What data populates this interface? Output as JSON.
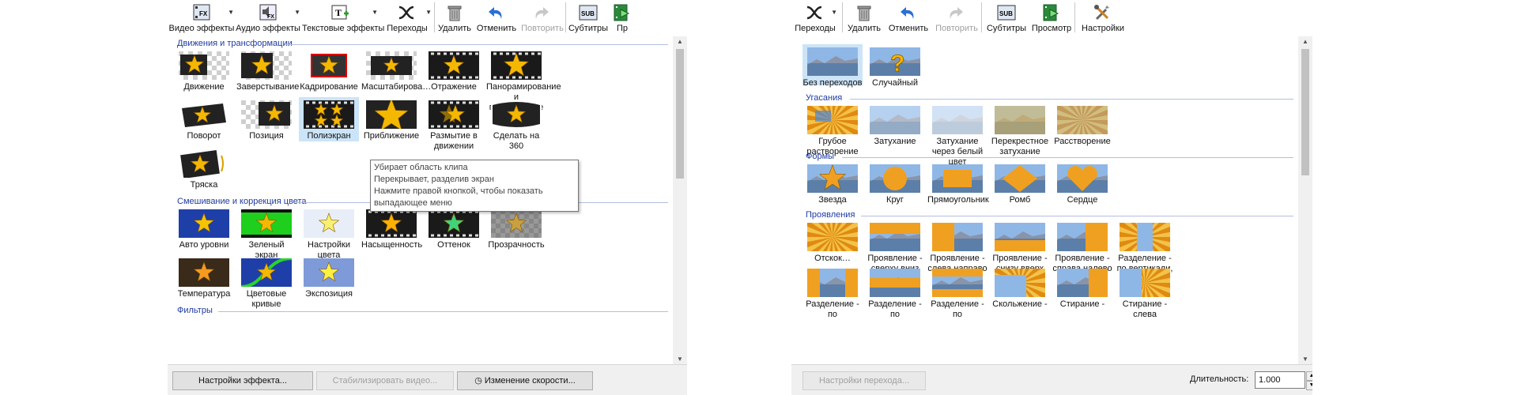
{
  "left_panel": {
    "toolbar": [
      {
        "name": "video-effects-button",
        "icon": "video-fx-icon",
        "label": "Видео эффекты",
        "dropdown": true,
        "enabled": true
      },
      {
        "name": "audio-effects-button",
        "icon": "audio-fx-icon",
        "label": "Аудио эффекты",
        "dropdown": true,
        "enabled": true
      },
      {
        "name": "text-effects-button",
        "icon": "text-fx-icon",
        "label": "Текстовые эффекты",
        "dropdown": true,
        "enabled": true
      },
      {
        "name": "transitions-button",
        "icon": "transitions-icon",
        "label": "Переходы",
        "dropdown": true,
        "enabled": true
      },
      {
        "name": "delete-button",
        "icon": "trash-icon",
        "label": "Удалить",
        "enabled": true
      },
      {
        "name": "undo-button",
        "icon": "undo-icon",
        "label": "Отменить",
        "enabled": true
      },
      {
        "name": "redo-button",
        "icon": "redo-icon",
        "label": "Повторить",
        "enabled": false
      },
      {
        "name": "subtitles-button",
        "icon": "subtitles-icon",
        "label": "Субтитры",
        "enabled": true
      },
      {
        "name": "preview-button",
        "icon": "preview-icon",
        "label": "Пр",
        "enabled": true
      }
    ],
    "categories": [
      {
        "title": "Движения и трансформации",
        "items": [
          {
            "label": "Движение",
            "thumb": "movement"
          },
          {
            "label": "Заверстывание",
            "thumb": "wrap"
          },
          {
            "label": "Кадрирование",
            "thumb": "crop"
          },
          {
            "label": "Масштабирова…",
            "thumb": "scale"
          },
          {
            "label": "Отражение",
            "thumb": "reflection"
          },
          {
            "label": "Панорамирование и приближение",
            "thumb": "pan"
          },
          {
            "label": "Поворот",
            "thumb": "rotate"
          },
          {
            "label": "Позиция",
            "thumb": "position"
          },
          {
            "label": "Полиэкран",
            "thumb": "multiscreen",
            "selected": true
          },
          {
            "label": "Приближение",
            "thumb": "zoom"
          },
          {
            "label": "Размытие в движении",
            "thumb": "motionblur"
          },
          {
            "label": "Сделать на 360",
            "thumb": "360"
          },
          {
            "label": "Тряска",
            "thumb": "shake"
          }
        ]
      },
      {
        "title": "Смешивание и коррекция цвета",
        "items": [
          {
            "label": "Авто уровни",
            "thumb": "autolevels"
          },
          {
            "label": "Зеленый экран",
            "thumb": "greenscreen"
          },
          {
            "label": "Настройки цвета",
            "thumb": "colorsettings"
          },
          {
            "label": "Насыщенность",
            "thumb": "saturation"
          },
          {
            "label": "Оттенок",
            "thumb": "hue"
          },
          {
            "label": "Прозрачность",
            "thumb": "transparency"
          },
          {
            "label": "Температура",
            "thumb": "temperature"
          },
          {
            "label": "Цветовые кривые",
            "thumb": "curves"
          },
          {
            "label": "Экспозиция",
            "thumb": "exposure"
          }
        ]
      },
      {
        "title": "Фильтры",
        "items": []
      }
    ],
    "tooltip": [
      "Убирает область клипа",
      "Перекрывает, разделив экран",
      "Нажмите правой кнопкой, чтобы показать",
      "выпадающее меню"
    ],
    "bottom_buttons": [
      {
        "name": "effect-settings-button",
        "label": "Настройки эффекта...",
        "enabled": true
      },
      {
        "name": "stabilize-video-button",
        "label": "Стабилизировать видео...",
        "enabled": false
      },
      {
        "name": "change-speed-button",
        "label": "Изменение скорости...",
        "enabled": true
      }
    ]
  },
  "right_panel": {
    "toolbar": [
      {
        "name": "transitions-button",
        "icon": "transitions-icon",
        "label": "Переходы",
        "dropdown": true,
        "enabled": true
      },
      {
        "name": "delete-button",
        "icon": "trash-icon",
        "label": "Удалить",
        "enabled": true
      },
      {
        "name": "undo-button",
        "icon": "undo-icon",
        "label": "Отменить",
        "enabled": true
      },
      {
        "name": "redo-button",
        "icon": "redo-icon",
        "label": "Повторить",
        "enabled": false
      },
      {
        "name": "subtitles-button",
        "icon": "subtitles-icon",
        "label": "Субтитры",
        "enabled": true
      },
      {
        "name": "preview-button",
        "icon": "preview-icon",
        "label": "Просмотр",
        "enabled": true
      },
      {
        "name": "settings-button",
        "icon": "tools-icon",
        "label": "Настройки",
        "enabled": true
      }
    ],
    "categories": [
      {
        "title": "",
        "items": [
          {
            "label": "Без переходов",
            "thumb": "none",
            "selected": true
          },
          {
            "label": "Случайный",
            "thumb": "random"
          }
        ]
      },
      {
        "title": "Угасания",
        "items": [
          {
            "label": "Грубое растворение",
            "thumb": "roughdissolve"
          },
          {
            "label": "Затухание",
            "thumb": "fade"
          },
          {
            "label": "Затухание через белый цвет",
            "thumb": "fadewhite"
          },
          {
            "label": "Перекрестное затухание",
            "thumb": "crossfade"
          },
          {
            "label": "Расстворение",
            "thumb": "dissolve"
          }
        ]
      },
      {
        "title": "Формы",
        "items": [
          {
            "label": "Звезда",
            "thumb": "star"
          },
          {
            "label": "Круг",
            "thumb": "circle"
          },
          {
            "label": "Прямоугольник",
            "thumb": "rect"
          },
          {
            "label": "Ромб",
            "thumb": "diamond"
          },
          {
            "label": "Сердце",
            "thumb": "heart"
          }
        ]
      },
      {
        "title": "Проявления",
        "items": [
          {
            "label": "Отскок…",
            "thumb": "bounce"
          },
          {
            "label": "Проявление - сверху вниз",
            "thumb": "wipe-down"
          },
          {
            "label": "Проявление - слева направо",
            "thumb": "wipe-right"
          },
          {
            "label": "Проявление - снизу вверх",
            "thumb": "wipe-up"
          },
          {
            "label": "Проявление - справа налево",
            "thumb": "wipe-left"
          },
          {
            "label": "Разделение - по вертикали, конец",
            "thumb": "split-vend"
          },
          {
            "label": "Разделение - по",
            "thumb": "split1"
          },
          {
            "label": "Разделение - по",
            "thumb": "split2"
          },
          {
            "label": "Разделение - по",
            "thumb": "split3"
          },
          {
            "label": "Скольжение -",
            "thumb": "slide"
          },
          {
            "label": "Стирание -",
            "thumb": "erase1"
          },
          {
            "label": "Стирание - слева",
            "thumb": "erase2"
          }
        ]
      }
    ],
    "bottom": {
      "transition_settings_label": "Настройки перехода...",
      "duration_label": "Длительность:",
      "duration_value": "1.000"
    }
  },
  "colors": {
    "category_title": "#1e3aa0",
    "accent": "#2b6fd6",
    "selection": "#cce4f7",
    "star": "#f5b800"
  }
}
